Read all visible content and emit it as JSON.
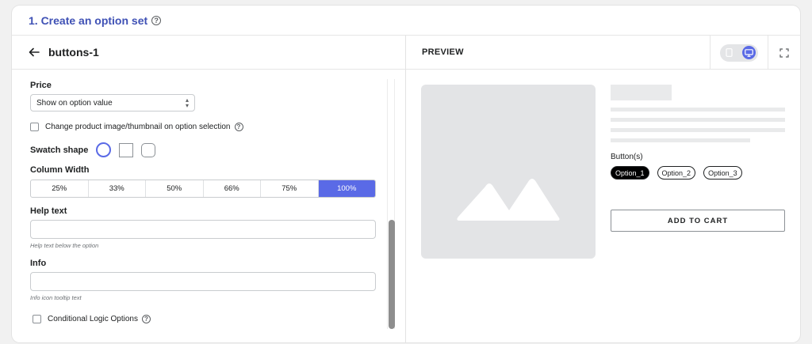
{
  "header": {
    "title": "1. Create an option set",
    "help_icon": "question-circle-icon"
  },
  "left_panel": {
    "back_icon": "arrow-left-icon",
    "option_set_name": "buttons-1",
    "price": {
      "label": "Price",
      "selected": "Show on option value"
    },
    "change_image": {
      "label": "Change product image/thumbnail on option selection",
      "checked": false
    },
    "swatch_shape": {
      "label": "Swatch shape",
      "options": [
        "circle",
        "square",
        "rounded"
      ],
      "selected": "circle"
    },
    "column_width": {
      "label": "Column Width",
      "options": [
        "25%",
        "33%",
        "50%",
        "66%",
        "75%",
        "100%"
      ],
      "selected": "100%"
    },
    "help_text": {
      "label": "Help text",
      "value": "",
      "hint": "Help text below the option"
    },
    "info": {
      "label": "Info",
      "value": "",
      "hint": "Info icon tooltip text"
    },
    "conditional_logic": {
      "label": "Conditional Logic Options",
      "checked": false
    }
  },
  "preview": {
    "title": "PREVIEW",
    "device_icons": [
      "mobile-icon",
      "desktop-icon"
    ],
    "active_device": "desktop",
    "expand_icon": "expand-icon",
    "buttons_label": "Button(s)",
    "options": [
      "Option_1",
      "Option_2",
      "Option_3"
    ],
    "selected_option": "Option_1",
    "add_to_cart": "ADD TO CART"
  },
  "colors": {
    "accent": "#5a6ae6",
    "title": "#3f51b5",
    "placeholder": "#e3e4e6"
  }
}
